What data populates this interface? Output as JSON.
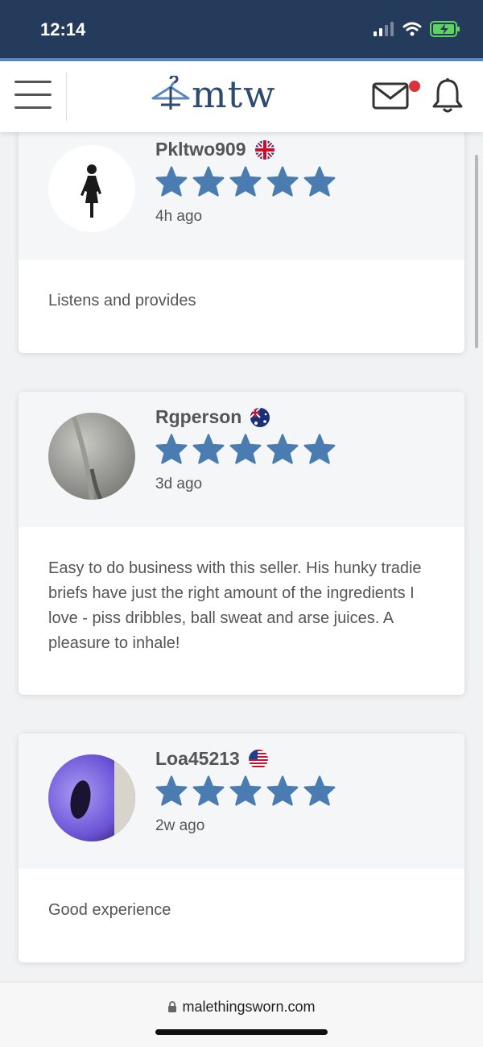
{
  "status_bar": {
    "time": "12:14"
  },
  "header": {
    "logo_text": "mtw"
  },
  "reviews": [
    {
      "username": "Pkltwo909",
      "flag": "uk-flag",
      "rating": 5,
      "time_ago": "4h ago",
      "text": "Listens and provides"
    },
    {
      "username": "Rgperson",
      "flag": "australia-flag",
      "rating": 5,
      "time_ago": "3d ago",
      "text": "Easy to do business with this seller. His hunky tradie briefs have just the right amount of the ingredients I love - piss dribbles, ball sweat and arse juices. A pleasure to inhale!"
    },
    {
      "username": "Loa45213",
      "flag": "us-flag",
      "rating": 5,
      "time_ago": "2w ago",
      "text": "Good experience"
    }
  ],
  "browser": {
    "url": "malethingsworn.com"
  },
  "colors": {
    "status_bar": "#253b5c",
    "accent": "#5b87bd",
    "star": "#4a7cb1",
    "notification_dot": "#d9323a"
  }
}
